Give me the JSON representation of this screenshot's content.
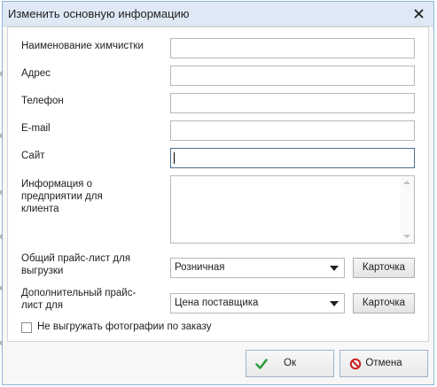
{
  "dialog": {
    "title": "Изменить основную информацию"
  },
  "fields": {
    "name_label": "Наименование химчистки",
    "name_value": "",
    "address_label": "Адрес",
    "address_value": "",
    "phone_label": "Телефон",
    "phone_value": "",
    "email_label": "E-mail",
    "email_value": "",
    "site_label": "Сайт",
    "site_value": "",
    "info_label": "Информация о предприятии для клиента",
    "info_value": "",
    "price_list_label": "Общий прайс-лист для выгрузки",
    "price_list_value": "Розничная",
    "extra_price_label": "Дополнительный прайс-лист для",
    "extra_price_value": "Цена поставщика",
    "card_button_label": "Карточка"
  },
  "options": {
    "no_photo_label": "Не выгружать фотографии по заказу",
    "no_photo_checked": false
  },
  "footer": {
    "ok_label": "Ок",
    "cancel_label": "Отмена"
  },
  "colors": {
    "ok_icon": "#2e9e3c",
    "cancel_icon": "#c8201f"
  }
}
